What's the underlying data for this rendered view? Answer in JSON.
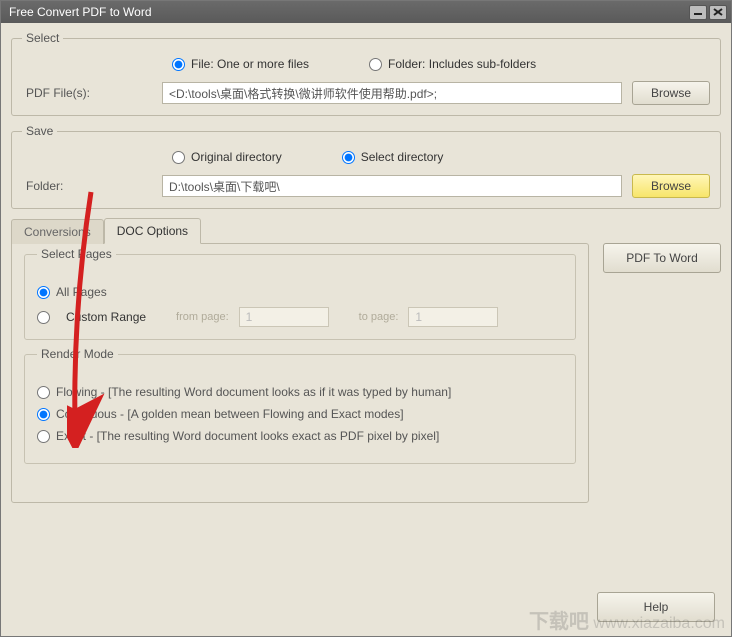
{
  "title": "Free Convert PDF to Word",
  "select": {
    "legend": "Select",
    "file_radio": "File:  One or more files",
    "folder_radio": "Folder: Includes sub-folders",
    "label": "PDF File(s):",
    "value": "<D:\\tools\\桌面\\格式转换\\微讲师软件使用帮助.pdf>;",
    "browse": "Browse"
  },
  "save": {
    "legend": "Save",
    "orig_radio": "Original directory",
    "sel_radio": "Select directory",
    "label": "Folder:",
    "value": "D:\\tools\\桌面\\下载吧\\",
    "browse": "Browse"
  },
  "tabs": {
    "conversions": "Conversions",
    "doc_options": "DOC Options"
  },
  "pages": {
    "legend": "Select Pages",
    "all": "All Pages",
    "custom": "Custom Range",
    "from": "from page:",
    "from_val": "1",
    "to": "to page:",
    "to_val": "1"
  },
  "render": {
    "legend": "Render Mode",
    "flowing": "Flowing - [The resulting Word document looks as if it was typed by human]",
    "continuous": "Continuous - [A golden mean between Flowing and Exact modes]",
    "exact": "Exact - [The resulting Word document looks exact as PDF pixel by pixel]"
  },
  "actions": {
    "pdf_to_word": "PDF To Word",
    "help": "Help"
  },
  "watermark": {
    "cn": "下载吧",
    "url": "www.xiazaiba.com"
  }
}
